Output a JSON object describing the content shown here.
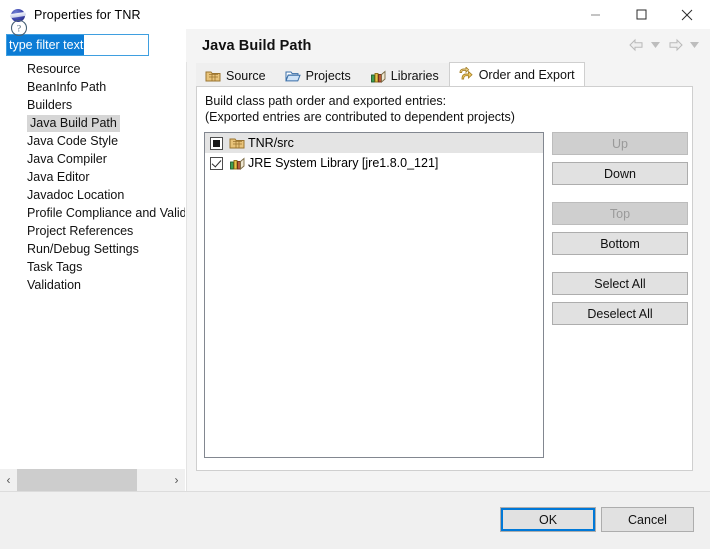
{
  "window": {
    "title": "Properties for TNR",
    "icon": "eclipse-sphere-icon",
    "controls": {
      "minimize": "minimize-icon",
      "maximize": "maximize-icon",
      "close": "close-icon"
    }
  },
  "filter": {
    "value": "type filter text",
    "placeholder": "type filter text",
    "selected": true
  },
  "sidebar": {
    "items": [
      {
        "label": "Resource",
        "selected": false
      },
      {
        "label": "BeanInfo Path",
        "selected": false
      },
      {
        "label": "Builders",
        "selected": false
      },
      {
        "label": "Java Build Path",
        "selected": true
      },
      {
        "label": "Java Code Style",
        "selected": false
      },
      {
        "label": "Java Compiler",
        "selected": false
      },
      {
        "label": "Java Editor",
        "selected": false
      },
      {
        "label": "Javadoc Location",
        "selected": false
      },
      {
        "label": "Profile Compliance and Valid",
        "selected": false
      },
      {
        "label": "Project References",
        "selected": false
      },
      {
        "label": "Run/Debug Settings",
        "selected": false
      },
      {
        "label": "Task Tags",
        "selected": false
      },
      {
        "label": "Validation",
        "selected": false
      }
    ],
    "scrollbar": {
      "left_arrow": "‹",
      "right_arrow": "›"
    }
  },
  "header": {
    "title": "Java Build Path",
    "nav": {
      "back": "back-arrow-icon",
      "back_menu": "chevron-down-icon",
      "forward": "forward-arrow-icon",
      "forward_menu": "chevron-down-icon",
      "enabled": false
    }
  },
  "tabs": [
    {
      "label": "Source",
      "icon": "source-folder-icon",
      "active": false
    },
    {
      "label": "Projects",
      "icon": "open-folder-icon",
      "active": false
    },
    {
      "label": "Libraries",
      "icon": "library-books-icon",
      "active": false
    },
    {
      "label": "Order and Export",
      "icon": "order-export-arrows-icon",
      "active": true
    }
  ],
  "panel": {
    "description_line1": "Build class path order and exported entries:",
    "description_line2": "(Exported entries are contributed to dependent projects)",
    "entries": [
      {
        "label": "TNR/src",
        "icon": "package-folder-icon",
        "check_state": "filled",
        "selected": true
      },
      {
        "label": "JRE System Library [jre1.8.0_121]",
        "icon": "library-books-icon",
        "check_state": "checked",
        "selected": false
      }
    ]
  },
  "side_buttons": [
    {
      "label": "Up",
      "enabled": false
    },
    {
      "label": "Down",
      "enabled": true
    },
    {
      "label": "Top",
      "enabled": false
    },
    {
      "label": "Bottom",
      "enabled": true
    },
    {
      "label": "Select All",
      "enabled": true
    },
    {
      "label": "Deselect All",
      "enabled": true
    }
  ],
  "footer": {
    "help": "help-question-icon",
    "ok": "OK",
    "cancel": "Cancel"
  },
  "colors": {
    "accent": "#0078d7",
    "selection": "#0c7cd5",
    "dialog_bg": "#f0f0f0",
    "panel_bg": "#f4f4f4"
  }
}
